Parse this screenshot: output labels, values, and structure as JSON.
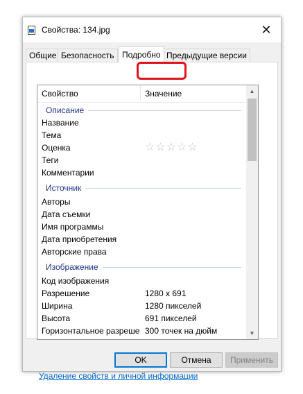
{
  "window": {
    "title": "Свойства: 134.jpg",
    "close_glyph": "✕",
    "icon": "image-file-icon"
  },
  "tabs": [
    {
      "label": "Общие"
    },
    {
      "label": "Безопасность"
    },
    {
      "label": "Подробно",
      "active": true
    },
    {
      "label": "Предыдущие версии"
    }
  ],
  "list": {
    "header": {
      "property": "Свойство",
      "value": "Значение"
    },
    "groups": {
      "description": "Описание",
      "source": "Источник",
      "image": "Изображение"
    },
    "rows": {
      "name": "Название",
      "subject": "Тема",
      "rating": "Оценка",
      "tags": "Теги",
      "comments": "Комментарии",
      "authors": "Авторы",
      "date_taken": "Дата съемки",
      "program_name": "Имя программы",
      "date_acquired": "Дата приобретения",
      "copyright": "Авторские права",
      "image_id": "Код изображения",
      "resolution": "Разрешение",
      "resolution_value": "1280 x 691",
      "width": "Ширина",
      "width_value": "1280 пикселей",
      "height": "Высота",
      "height_value": "691 пикселей",
      "hres": "Горизонтальное разреше",
      "hres_value": "300 точек на дюйм"
    },
    "rating_stars": "☆☆☆☆☆",
    "rating_value": 0
  },
  "remove_link": "Удаление свойств и личной информации",
  "buttons": {
    "ok": "OK",
    "cancel": "Отмена",
    "apply": "Применить"
  },
  "colors": {
    "highlight": "#e0121b",
    "group_text": "#1e3287",
    "link": "#0066cc",
    "primary_border": "#0078d7"
  }
}
